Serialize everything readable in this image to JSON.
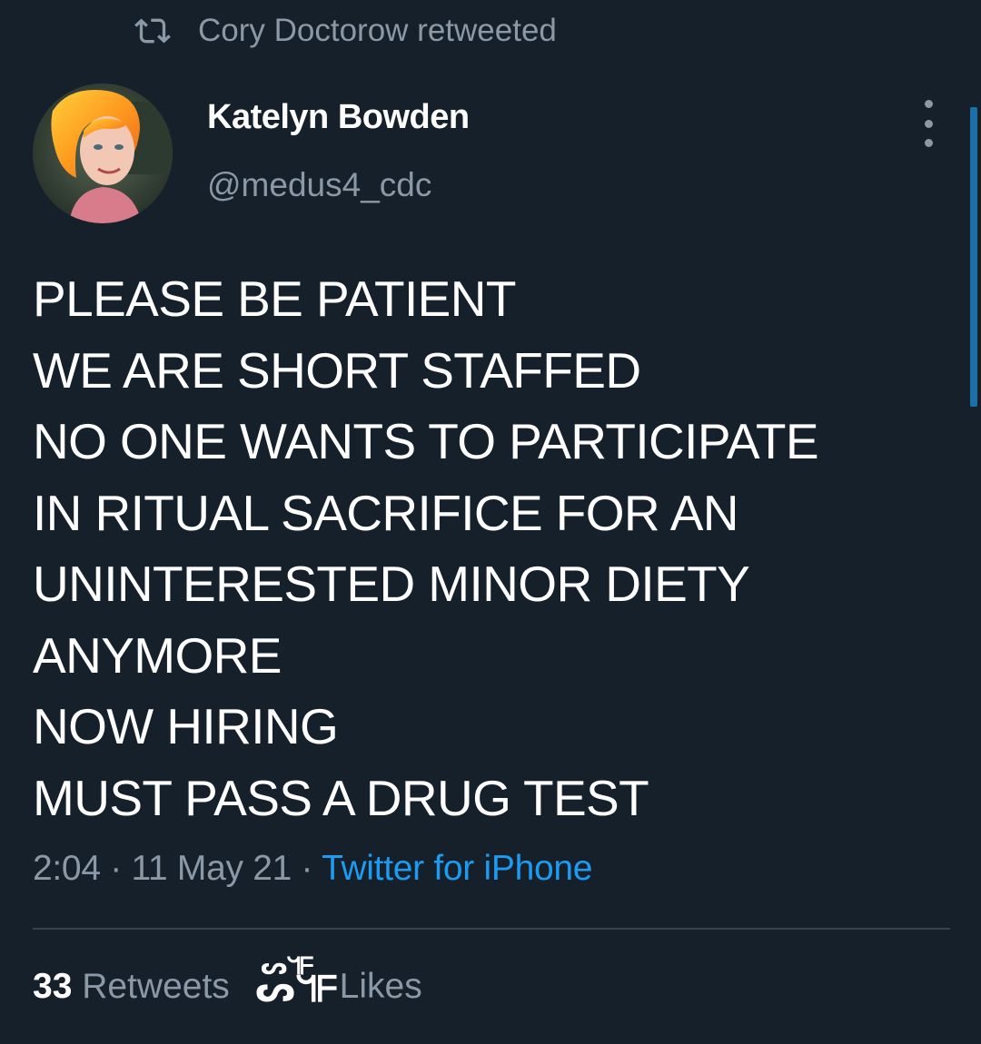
{
  "retweet_context": {
    "icon": "retweet-icon",
    "text": "Cory Doctorow retweeted"
  },
  "author": {
    "name": "Katelyn Bowden",
    "handle": "@medus4_cdc",
    "avatar_icon": "profile-photo"
  },
  "more_icon": "more-vertical-icon",
  "tweet": {
    "lines": [
      "PLEASE BE PATIENT",
      "WE ARE SHORT STAFFED",
      "NO ONE WANTS TO PARTICIPATE",
      "IN RITUAL SACRIFICE FOR AN",
      "UNINTERESTED MINOR DIETY",
      "ANYMORE",
      "NOW HIRING",
      "MUST PASS A DRUG TEST"
    ]
  },
  "meta": {
    "time": "2:04",
    "separator": " · ",
    "date": "11 May 21",
    "source": "Twitter for iPhone"
  },
  "stats": {
    "retweets_count": "33",
    "retweets_label": "Retweets",
    "likes_count_glyph": "ᔕᖻᖴ",
    "likes_count_overlay": "ᔕᖻᖴ",
    "likes_label": "Likes"
  },
  "colors": {
    "background": "#15202b",
    "text_primary": "#ffffff",
    "text_secondary": "#8b98a5",
    "link": "#1d9bf0",
    "divider": "#38444d"
  }
}
